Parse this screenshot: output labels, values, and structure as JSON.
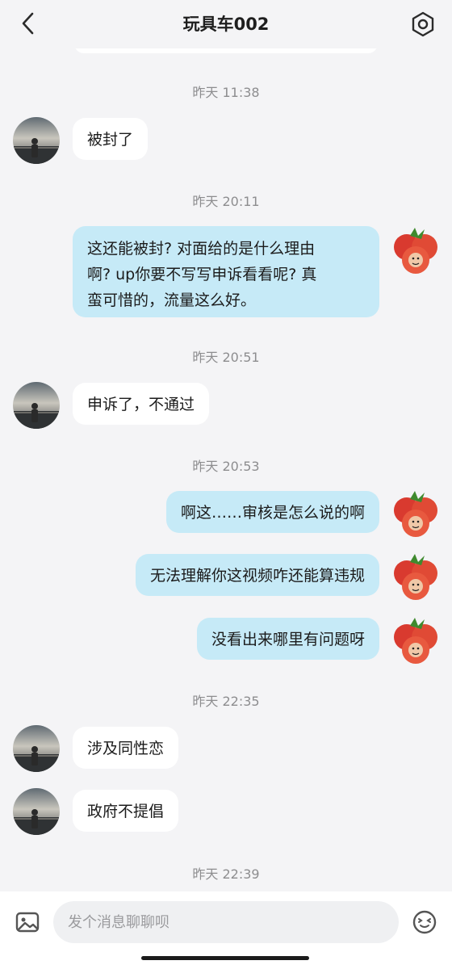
{
  "header": {
    "title": "玩具车002",
    "back_icon": "chevron-left-icon",
    "settings_icon": "settings-gear-icon"
  },
  "messages": [
    {
      "time": "昨天 11:38"
    },
    {
      "side": "in",
      "text": "被封了"
    },
    {
      "time": "昨天 20:11"
    },
    {
      "side": "out",
      "lines": [
        "这还能被封? 对面给的是什么理由",
        "啊? up你要不写写申诉看看呢? 真",
        "蛮可惜的，流量这么好。"
      ]
    },
    {
      "time": "昨天 20:51"
    },
    {
      "side": "in",
      "text": "申诉了，不通过"
    },
    {
      "time": "昨天 20:53"
    },
    {
      "side": "out",
      "text": "啊这……审核是怎么说的啊"
    },
    {
      "side": "out",
      "text": "无法理解你这视频咋还能算违规"
    },
    {
      "side": "out",
      "text": "没看出来哪里有问题呀"
    },
    {
      "time": "昨天 22:35"
    },
    {
      "side": "in",
      "text": "涉及同性恋"
    },
    {
      "side": "in",
      "text": "政府不提倡"
    },
    {
      "time": "昨天 22:39"
    }
  ],
  "input": {
    "placeholder": "发个消息聊聊呗",
    "value": ""
  },
  "footer": {
    "image_icon": "image-icon",
    "emoji_icon": "emoji-icon"
  },
  "colors": {
    "background": "#f4f4f6",
    "incoming_bubble": "#ffffff",
    "outgoing_bubble": "#c6eaf7",
    "timestamp": "#8d8d8f"
  }
}
